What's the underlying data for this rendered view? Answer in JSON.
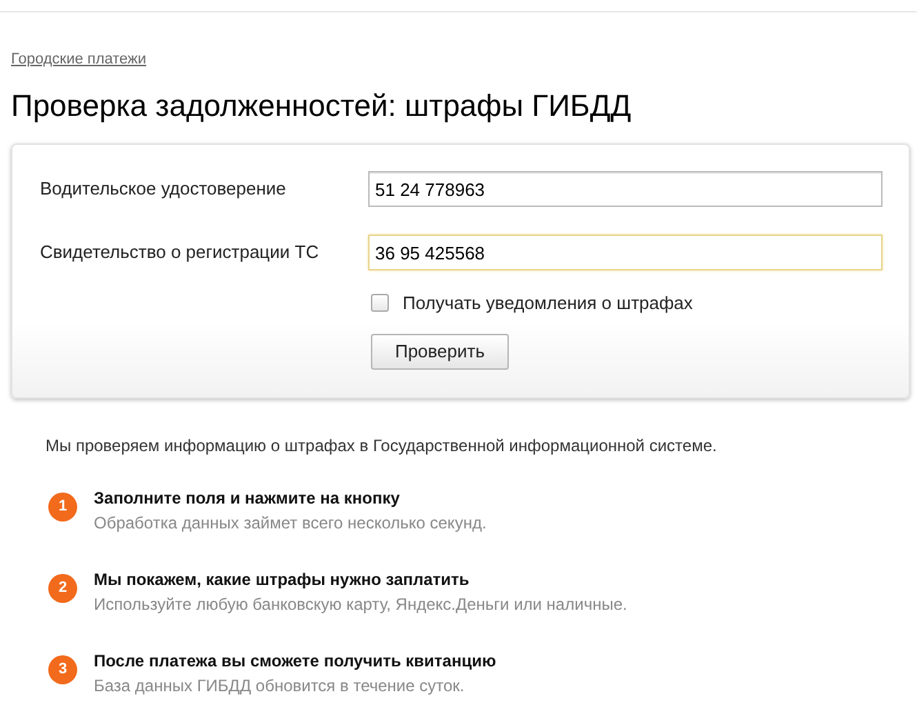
{
  "breadcrumb": "Городские платежи",
  "title": "Проверка задолженностей: штрафы ГИБДД",
  "form": {
    "fields": [
      {
        "label": "Водительское удостоверение",
        "value": "51 24 778963",
        "focused": false
      },
      {
        "label": "Свидетельство о регистрации ТС",
        "value": "36 95 425568",
        "focused": true
      }
    ],
    "notify": {
      "label": "Получать уведомления о штрафах",
      "checked": false
    },
    "submit": "Проверить"
  },
  "info": "Мы проверяем информацию о штрафах в Государственной информационной системе.",
  "steps": [
    {
      "number": "1",
      "title": "Заполните поля и нажмите на кнопку",
      "text": "Обработка данных займет всего несколько секунд."
    },
    {
      "number": "2",
      "title": "Мы покажем, какие штрафы нужно заплатить",
      "text": "Используйте любую банковскую карту, Яндекс.Деньги или наличные."
    },
    {
      "number": "3",
      "title": "После платежа вы сможете получить квитанцию",
      "text": "База данных ГИБДД обновится в течение суток."
    }
  ]
}
